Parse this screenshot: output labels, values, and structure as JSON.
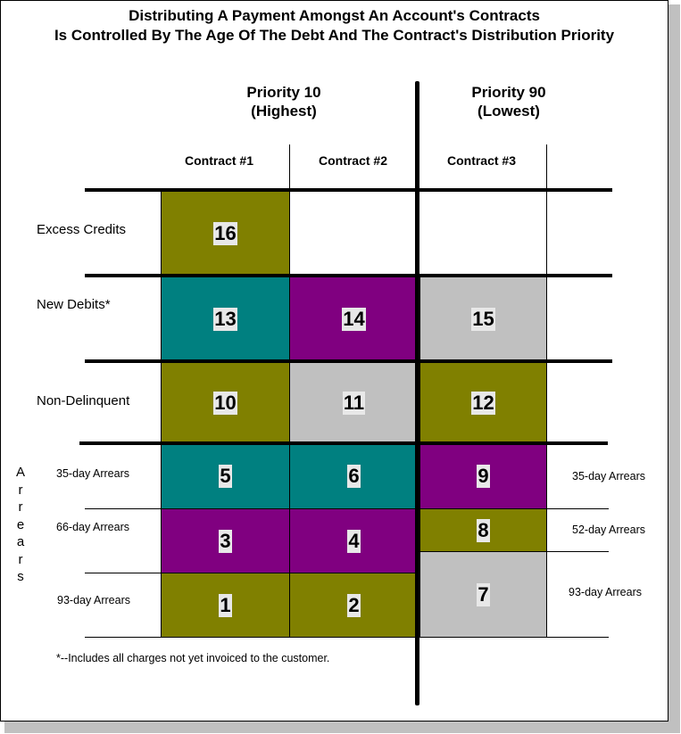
{
  "title": {
    "line1": "Distributing A Payment Amongst An Account's Contracts",
    "line2": "Is Controlled By The Age Of The Debt And The Contract's Distribution Priority"
  },
  "priorities": [
    {
      "label": "Priority 10",
      "sub": "(Highest)"
    },
    {
      "label": "Priority 90",
      "sub": "(Lowest)"
    }
  ],
  "contracts": [
    "Contract #1",
    "Contract #2",
    "Contract #3"
  ],
  "row_labels": {
    "excess_credits": "Excess Credits",
    "new_debits": "New Debits*",
    "non_delinquent": "Non-Delinquent",
    "arrears_vertical": [
      "A",
      "r",
      "r",
      "e",
      "a",
      "r",
      "s"
    ],
    "left_arrears": [
      "35-day Arrears",
      "66-day Arrears",
      "93-day Arrears"
    ],
    "right_arrears": [
      "35-day Arrears",
      "52-day Arrears",
      "93-day Arrears"
    ]
  },
  "colors": {
    "olive": "#808000",
    "teal": "#008080",
    "purple": "#800080",
    "gray": "#c0c0c0",
    "number_bg": "#e8e8e8"
  },
  "cells": {
    "c16": {
      "number": "16",
      "color": "olive"
    },
    "c13": {
      "number": "13",
      "color": "teal"
    },
    "c14": {
      "number": "14",
      "color": "purple"
    },
    "c15": {
      "number": "15",
      "color": "gray"
    },
    "c10": {
      "number": "10",
      "color": "olive"
    },
    "c11": {
      "number": "11",
      "color": "gray"
    },
    "c12": {
      "number": "12",
      "color": "olive"
    },
    "c5": {
      "number": "5",
      "color": "teal"
    },
    "c6": {
      "number": "6",
      "color": "teal"
    },
    "c9": {
      "number": "9",
      "color": "purple"
    },
    "c3": {
      "number": "3",
      "color": "purple"
    },
    "c4": {
      "number": "4",
      "color": "purple"
    },
    "c8": {
      "number": "8",
      "color": "olive"
    },
    "c1": {
      "number": "1",
      "color": "olive"
    },
    "c2": {
      "number": "2",
      "color": "olive"
    },
    "c7": {
      "number": "7",
      "color": "gray"
    }
  },
  "footnote": "*--Includes all charges not yet invoiced to the customer."
}
